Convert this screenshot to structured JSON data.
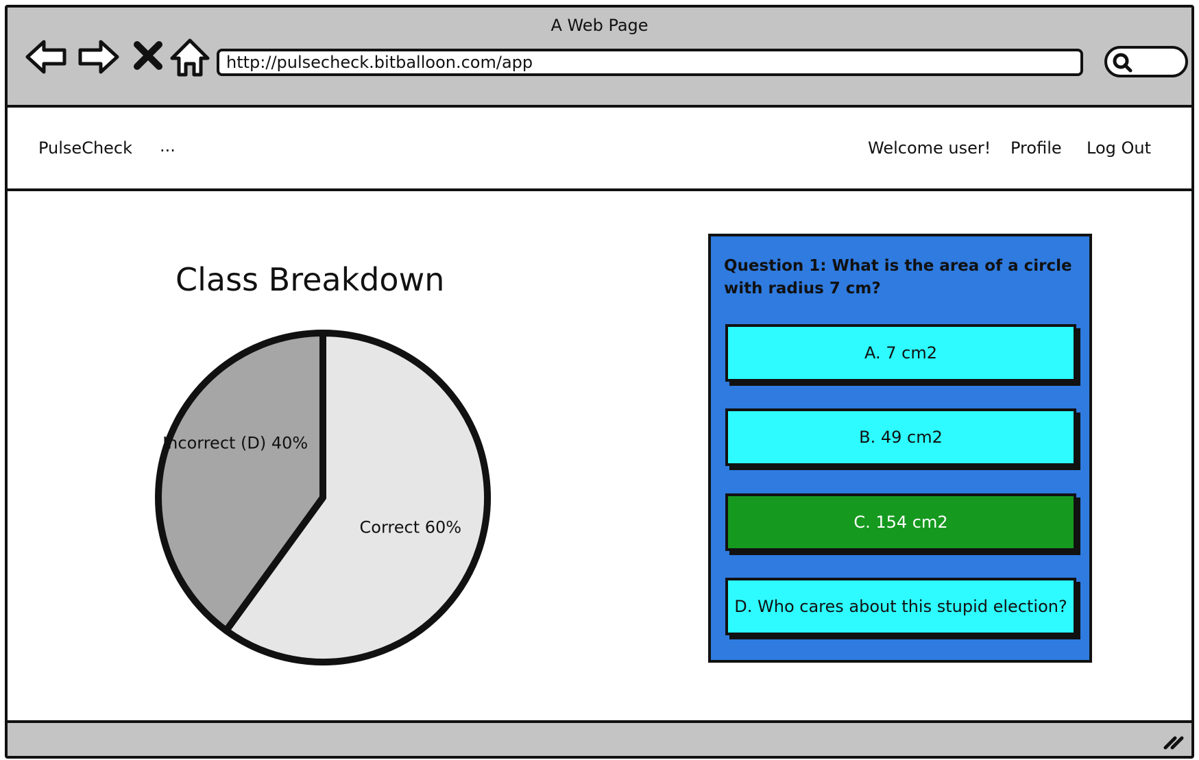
{
  "browser": {
    "window_title": "A Web Page",
    "url": "http://pulsecheck.bitballoon.com/app",
    "icons": [
      "back-arrow-icon",
      "forward-arrow-icon",
      "close-x-icon",
      "home-icon",
      "search-icon",
      "resize-grip-icon"
    ]
  },
  "appbar": {
    "brand": "PulseCheck",
    "more": "...",
    "welcome": "Welcome user!",
    "profile": "Profile",
    "logout": "Log Out"
  },
  "chart_data": {
    "type": "pie",
    "title": "Class Breakdown",
    "slices": [
      {
        "label": "Correct 60%",
        "value": 60,
        "color": "#e6e6e6"
      },
      {
        "label": "Incorrect (D) 40%",
        "value": 40,
        "color": "#a6a6a6"
      }
    ],
    "legend": "none"
  },
  "quiz": {
    "question": "Question 1:  What is the area of a circle with radius 7 cm?",
    "panel_color": "#2f7be0",
    "answers": [
      {
        "label": "A. 7 cm2",
        "color": "#2dfbff"
      },
      {
        "label": "B. 49 cm2",
        "color": "#2dfbff"
      },
      {
        "label": "C. 154 cm2",
        "color": "#16991f"
      },
      {
        "label": "D. Who cares about this stupid election?",
        "color": "#2dfbff"
      }
    ]
  }
}
